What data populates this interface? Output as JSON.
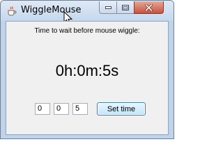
{
  "window": {
    "title": "WiggleMouse",
    "icon": "java-cup-icon",
    "controls": [
      "minimize",
      "maximize",
      "close"
    ]
  },
  "main": {
    "label": "Time to wait before mouse wiggle:",
    "countdown": "0h:0m:5s",
    "hours_value": "0",
    "minutes_value": "0",
    "seconds_value": "5",
    "set_button_label": "Set time"
  },
  "colors": {
    "close_button": "#c9513c",
    "window_frame": "#bfd3ea",
    "content_background": "#f0f0f0",
    "button_focus_border": "#3c7fb1"
  }
}
